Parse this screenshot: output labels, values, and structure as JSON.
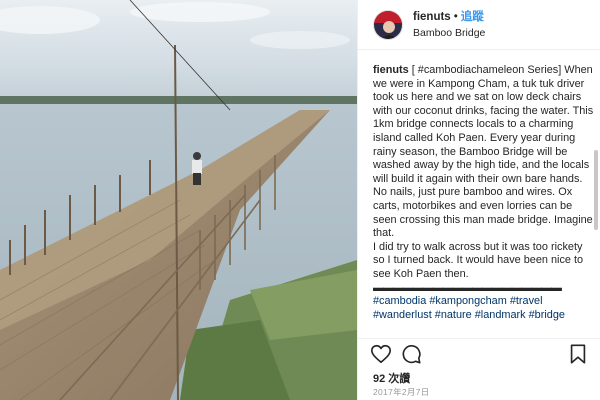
{
  "post": {
    "username": "fienuts",
    "separator": "•",
    "follow_label": "追蹤",
    "location": "Bamboo Bridge"
  },
  "caption": {
    "user": "fienuts",
    "text": "[ #cambodiachameleon Series] When we were in Kampong Cham, a tuk tuk driver took us here and we sat on low deck chairs with our coconut drinks, facing the water. This 1km bridge connects locals to a charming island called Koh Paen. Every year during rainy season, the Bamboo Bridge will be washed away by the high tide, and the locals will build it again with their own bare hands. No nails, just pure bamboo and wires. Ox carts, motorbikes and even lorries can be seen crossing this man made bridge. Imagine that.\nI did try to walk across but it was too rickety so I turned back. It would have been nice to see Koh Paen then.",
    "dashes": "▬▬▬▬▬▬▬▬▬▬▬▬▬▬▬▬▬▬▬",
    "hashtags": [
      "#cambodia",
      "#kampongcham",
      "#travel",
      "#wanderlust",
      "#nature",
      "#landmark",
      "#bridge"
    ]
  },
  "stats": {
    "likes": "92 次讚",
    "date": "2017年2月7日"
  },
  "icons": {
    "like": "heart-icon",
    "comment": "comment-icon",
    "save": "bookmark-icon"
  },
  "colors": {
    "link": "#003569",
    "follow": "#3897f0",
    "muted": "#999999"
  }
}
